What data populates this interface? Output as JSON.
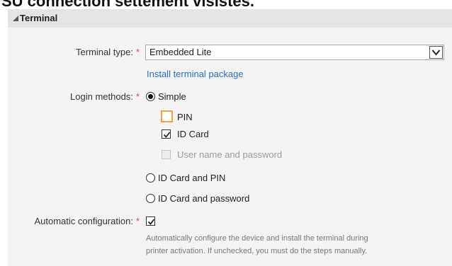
{
  "top_fragment": "SU connection settement visistes.",
  "section": {
    "title": "Terminal",
    "collapse_icon": "collapse-triangle-icon"
  },
  "terminal_type": {
    "label": "Terminal type:",
    "required_marker": "*",
    "selected_value": "Embedded Lite",
    "dropdown_icon": "chevron-down-icon",
    "install_link": "Install terminal package"
  },
  "login_methods": {
    "label": "Login methods:",
    "required_marker": "*",
    "options": [
      {
        "label": "Simple",
        "selected": true
      },
      {
        "label": "ID Card and PIN",
        "selected": false
      },
      {
        "label": "ID Card and password",
        "selected": false
      }
    ],
    "simple_suboptions": [
      {
        "label": "PIN",
        "checked": false,
        "disabled": false,
        "focused": true
      },
      {
        "label": "ID Card",
        "checked": true,
        "disabled": false,
        "focused": false
      },
      {
        "label": "User name and password",
        "checked": false,
        "disabled": true,
        "focused": false
      }
    ]
  },
  "automatic_configuration": {
    "label": "Automatic configuration:",
    "required_marker": "*",
    "checked": true,
    "help_line_1": "Automatically configure the device and install the terminal during",
    "help_line_2": "printer activation. If unchecked, you must do the steps manually."
  },
  "colors": {
    "header_bg": "#e4e4e4",
    "body_bg": "#f4f4f4",
    "link": "#2a6ebb",
    "required": "#d9534f",
    "focus_outline": "#f0a040",
    "help_text": "#777777"
  }
}
